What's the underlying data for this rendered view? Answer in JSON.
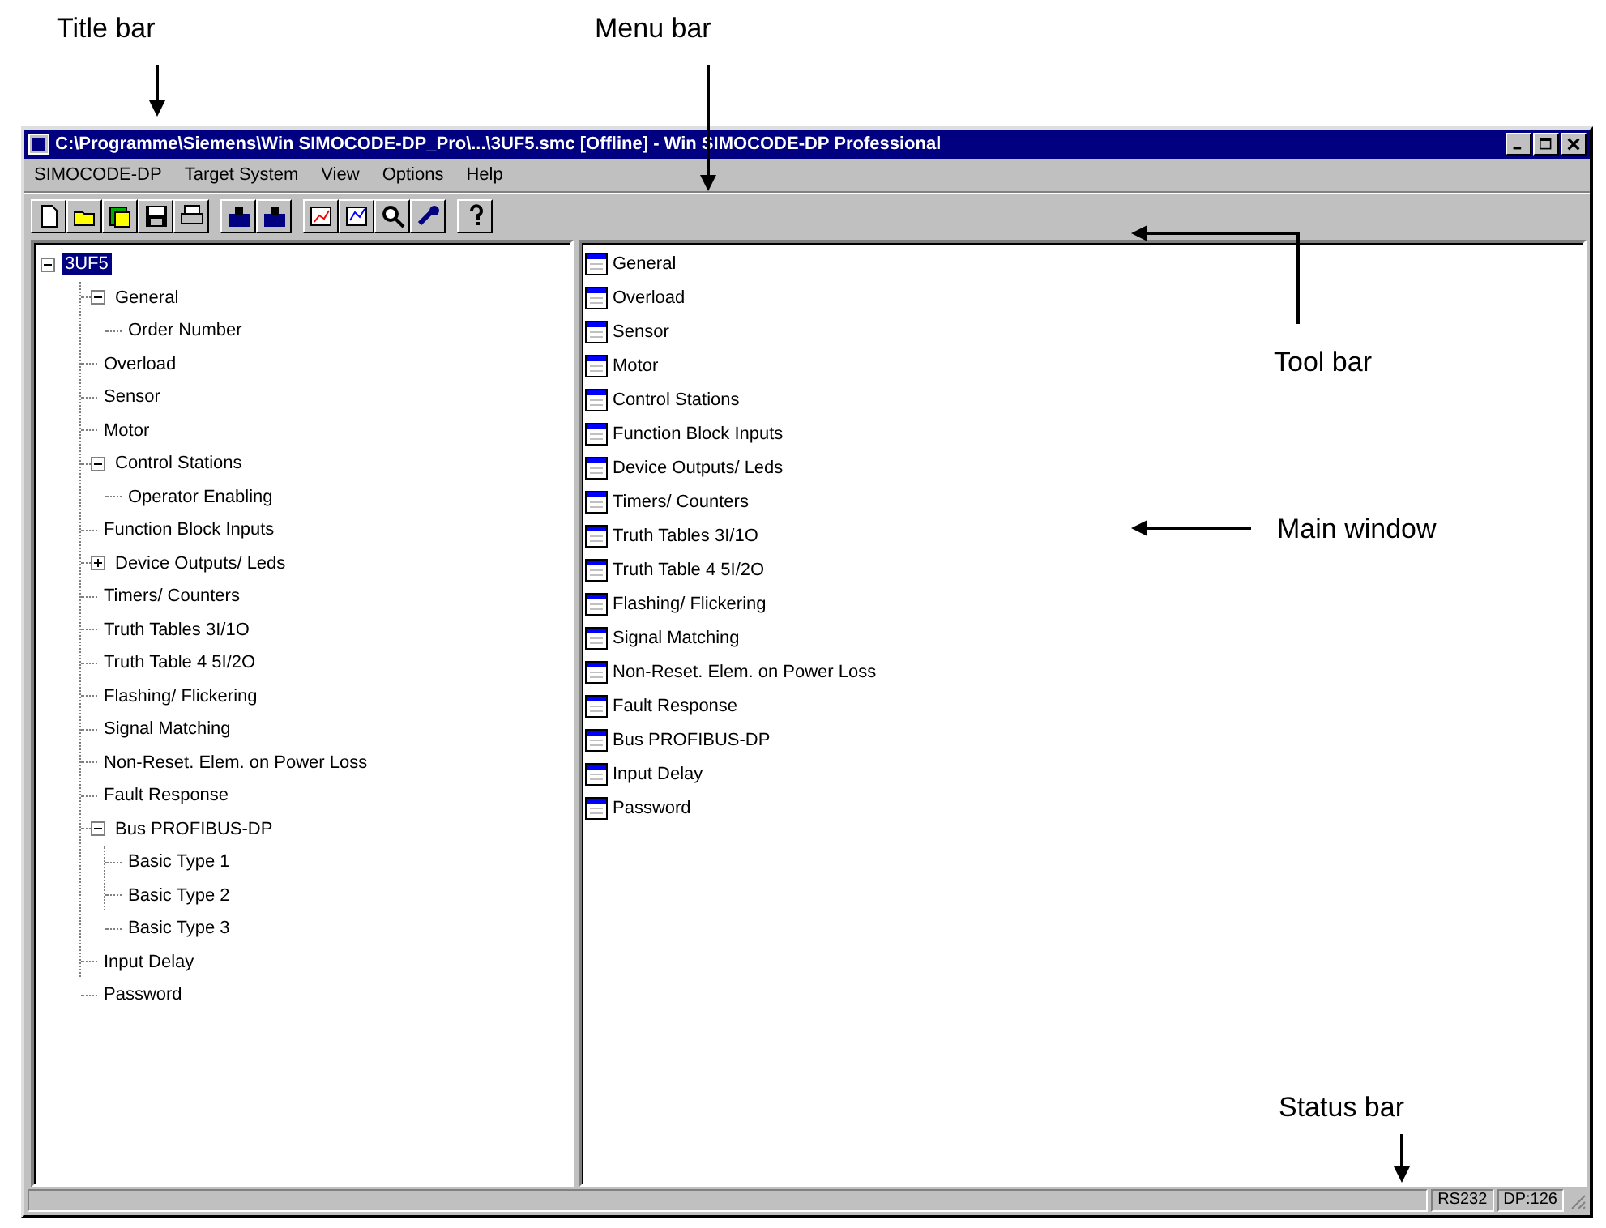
{
  "annotations": [
    {
      "kind": "title",
      "label": "Title bar"
    },
    {
      "kind": "menu",
      "label": "Menu bar"
    },
    {
      "kind": "tool",
      "label": "Tool bar"
    },
    {
      "kind": "main",
      "label": "Main window"
    },
    {
      "kind": "status",
      "label": "Status bar"
    }
  ],
  "window": {
    "title": "C:\\Programme\\Siemens\\Win SIMOCODE-DP_Pro\\...\\3UF5.smc [Offline] - Win SIMOCODE-DP Professional"
  },
  "menu": [
    "SIMOCODE-DP",
    "Target System",
    "View",
    "Options",
    "Help"
  ],
  "tree": {
    "label": "3UF5",
    "selected": true,
    "expanded": true,
    "children": [
      {
        "label": "General",
        "selected": false,
        "expanded": true,
        "children": [
          {
            "label": "Order Number",
            "selected": false
          }
        ]
      },
      {
        "label": "Overload",
        "selected": false
      },
      {
        "label": "Sensor",
        "selected": false
      },
      {
        "label": "Motor",
        "selected": false
      },
      {
        "label": "Control Stations",
        "selected": false,
        "expanded": true,
        "children": [
          {
            "label": "Operator Enabling",
            "selected": false
          }
        ]
      },
      {
        "label": "Function Block Inputs",
        "selected": false
      },
      {
        "label": "Device Outputs/ Leds",
        "selected": false,
        "expanded": false
      },
      {
        "label": "Timers/ Counters",
        "selected": false
      },
      {
        "label": "Truth Tables 3I/1O",
        "selected": false
      },
      {
        "label": "Truth Table 4 5I/2O",
        "selected": false
      },
      {
        "label": "Flashing/ Flickering",
        "selected": false
      },
      {
        "label": "Signal Matching",
        "selected": false
      },
      {
        "label": "Non-Reset. Elem. on Power Loss",
        "selected": false
      },
      {
        "label": "Fault Response",
        "selected": false
      },
      {
        "label": "Bus PROFIBUS-DP",
        "selected": false,
        "expanded": true,
        "children": [
          {
            "label": "Basic Type 1",
            "selected": false
          },
          {
            "label": "Basic Type 2",
            "selected": false
          },
          {
            "label": "Basic Type 3",
            "selected": false
          }
        ]
      },
      {
        "label": "Input Delay",
        "selected": false
      },
      {
        "label": "Password",
        "selected": false
      }
    ]
  },
  "list": [
    "General",
    "Overload",
    "Sensor",
    "Motor",
    "Control Stations",
    "Function Block Inputs",
    "Device Outputs/ Leds",
    "Timers/ Counters",
    "Truth Tables 3I/1O",
    "Truth Table 4 5I/2O",
    "Flashing/ Flickering",
    "Signal Matching",
    "Non-Reset. Elem. on Power Loss",
    "Fault Response",
    "Bus PROFIBUS-DP",
    "Input Delay",
    "Password"
  ],
  "status_bar": [
    "RS232",
    "DP:126"
  ]
}
